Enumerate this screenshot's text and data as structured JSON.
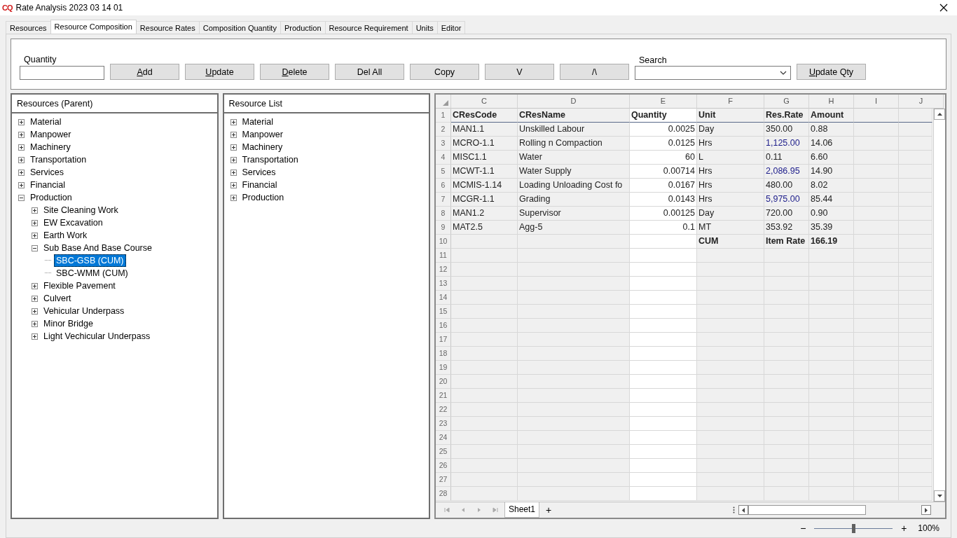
{
  "window": {
    "logo": "CQ",
    "title": "Rate Analysis 2023 03 14 01"
  },
  "tabs": [
    {
      "label": "Resources",
      "selected": false
    },
    {
      "label": "Resource Composition",
      "selected": true
    },
    {
      "label": "Resource Rates",
      "selected": false
    },
    {
      "label": "Composition Quantity",
      "selected": false
    },
    {
      "label": "Production",
      "selected": false
    },
    {
      "label": "Resource Requirement",
      "selected": false
    },
    {
      "label": "Units",
      "selected": false
    },
    {
      "label": "Editor",
      "selected": false
    }
  ],
  "toolbar": {
    "quantity_label": "Quantity",
    "search_label": "Search",
    "buttons": [
      {
        "label": "Add",
        "mnemonic": true
      },
      {
        "label": "Update",
        "mnemonic": true
      },
      {
        "label": "Delete",
        "mnemonic": true
      },
      {
        "label": "Del All",
        "mnemonic": false
      },
      {
        "label": "Copy",
        "mnemonic": false
      },
      {
        "label": "V",
        "mnemonic": false
      },
      {
        "label": "/\\",
        "mnemonic": false
      }
    ],
    "update_qty": {
      "label": "Update Qty",
      "mnemonic": true
    }
  },
  "parent_tree": {
    "title": "Resources (Parent)",
    "items": [
      {
        "label": "Material",
        "expanded": false,
        "selected": false
      },
      {
        "label": "Manpower",
        "expanded": false,
        "selected": false
      },
      {
        "label": "Machinery",
        "expanded": false,
        "selected": false
      },
      {
        "label": "Transportation",
        "expanded": false,
        "selected": false
      },
      {
        "label": "Services",
        "expanded": false,
        "selected": false
      },
      {
        "label": "Financial",
        "expanded": false,
        "selected": false
      },
      {
        "label": "Production",
        "expanded": true,
        "selected": false,
        "children": [
          {
            "label": "Site Cleaning Work",
            "expanded": false,
            "selected": false
          },
          {
            "label": "EW Excavation",
            "expanded": false,
            "selected": false
          },
          {
            "label": "Earth Work",
            "expanded": false,
            "selected": false
          },
          {
            "label": "Sub Base And Base Course",
            "expanded": true,
            "selected": false,
            "children": [
              {
                "label": "SBC-GSB (CUM)",
                "selected": true
              },
              {
                "label": "SBC-WMM (CUM)",
                "selected": false
              }
            ]
          },
          {
            "label": "Flexible Pavement",
            "expanded": false,
            "selected": false
          },
          {
            "label": "Culvert",
            "expanded": false,
            "selected": false
          },
          {
            "label": "Vehicular Underpass",
            "expanded": false,
            "selected": false
          },
          {
            "label": "Minor Bridge",
            "expanded": false,
            "selected": false
          },
          {
            "label": "Light Vechicular Underpass",
            "expanded": false,
            "selected": false
          }
        ]
      }
    ]
  },
  "resource_list": {
    "title": "Resource List",
    "items": [
      {
        "label": "Material",
        "expanded": false,
        "selected": false
      },
      {
        "label": "Manpower",
        "expanded": false,
        "selected": false
      },
      {
        "label": "Machinery",
        "expanded": false,
        "selected": false
      },
      {
        "label": "Transportation",
        "expanded": false,
        "selected": false
      },
      {
        "label": "Services",
        "expanded": false,
        "selected": false
      },
      {
        "label": "Financial",
        "expanded": false,
        "selected": false
      },
      {
        "label": "Production",
        "expanded": false,
        "selected": false
      }
    ]
  },
  "sheet": {
    "columns": [
      {
        "heading": "C",
        "kind": "plain"
      },
      {
        "heading": "D",
        "kind": "plain"
      },
      {
        "heading": "E",
        "kind": "input"
      },
      {
        "heading": "F",
        "kind": "plain"
      },
      {
        "heading": "G",
        "kind": "plain"
      },
      {
        "heading": "H",
        "kind": "plain"
      },
      {
        "heading": "I",
        "kind": "plain"
      },
      {
        "heading": "J",
        "kind": "plain"
      }
    ],
    "rows": [
      {
        "number": "1",
        "kind": "header",
        "code": "CResCode",
        "name": "CResName",
        "quantity": "Quantity",
        "unit": "Unit",
        "rate": {
          "text": "Res.Rate"
        },
        "amount": "Amount"
      },
      {
        "number": "2",
        "kind": "data",
        "code": "MAN1.1",
        "name": "Unskilled Labour",
        "quantity": "0.0025",
        "unit": "Day",
        "rate": {
          "text": "350.00"
        },
        "amount": "0.88"
      },
      {
        "number": "3",
        "kind": "data",
        "code": "MCRO-1.1",
        "name": "Rolling n Compaction",
        "quantity": "0.0125",
        "unit": "Hrs",
        "rate": {
          "text": "1,125.00",
          "color": "#1c1c8a"
        },
        "amount": "14.06"
      },
      {
        "number": "4",
        "kind": "data",
        "code": "MISC1.1",
        "name": "Water",
        "quantity": "60",
        "unit": "L",
        "rate": {
          "text": "0.11"
        },
        "amount": "6.60"
      },
      {
        "number": "5",
        "kind": "data",
        "code": "MCWT-1.1",
        "name": "Water Supply",
        "quantity": "0.00714",
        "unit": "Hrs",
        "rate": {
          "text": "2,086.95",
          "color": "#1c1c8a"
        },
        "amount": "14.90"
      },
      {
        "number": "6",
        "kind": "data",
        "code": "MCMIS-1.14",
        "name": "Loading Unloading Cost fo",
        "quantity": "0.0167",
        "unit": "Hrs",
        "rate": {
          "text": "480.00"
        },
        "amount": "8.02"
      },
      {
        "number": "7",
        "kind": "data",
        "code": "MCGR-1.1",
        "name": "Grading",
        "quantity": "0.0143",
        "unit": "Hrs",
        "rate": {
          "text": "5,975.00",
          "color": "#1c1c8a"
        },
        "amount": "85.44"
      },
      {
        "number": "8",
        "kind": "data",
        "code": "MAN1.2",
        "name": "Supervisor",
        "quantity": "0.00125",
        "unit": "Day",
        "rate": {
          "text": "720.00"
        },
        "amount": "0.90"
      },
      {
        "number": "9",
        "kind": "data",
        "code": "MAT2.5",
        "name": "Agg-5",
        "quantity": "0.1",
        "unit": "MT",
        "rate": {
          "text": "353.92"
        },
        "amount": "35.39"
      },
      {
        "number": "10",
        "kind": "total",
        "unit": "CUM",
        "rate": {
          "text": "Item Rate"
        },
        "amount": "166.19"
      },
      {
        "number": "11",
        "kind": "data"
      },
      {
        "number": "12",
        "kind": "data"
      },
      {
        "number": "13",
        "kind": "data"
      },
      {
        "number": "14",
        "kind": "data"
      },
      {
        "number": "15",
        "kind": "data"
      },
      {
        "number": "16",
        "kind": "data"
      },
      {
        "number": "17",
        "kind": "data"
      },
      {
        "number": "18",
        "kind": "data"
      },
      {
        "number": "19",
        "kind": "data"
      },
      {
        "number": "20",
        "kind": "data"
      },
      {
        "number": "21",
        "kind": "data"
      },
      {
        "number": "22",
        "kind": "data"
      },
      {
        "number": "23",
        "kind": "data"
      },
      {
        "number": "24",
        "kind": "data"
      },
      {
        "number": "25",
        "kind": "data"
      },
      {
        "number": "26",
        "kind": "data"
      },
      {
        "number": "27",
        "kind": "data"
      },
      {
        "number": "28",
        "kind": "data"
      }
    ],
    "sheet_tabs": [
      {
        "label": "Sheet1",
        "selected": true
      }
    ],
    "add_sheet": "+"
  },
  "zoom": {
    "minus": "−",
    "plus": "+",
    "level": 0.5,
    "reading": "100%"
  }
}
